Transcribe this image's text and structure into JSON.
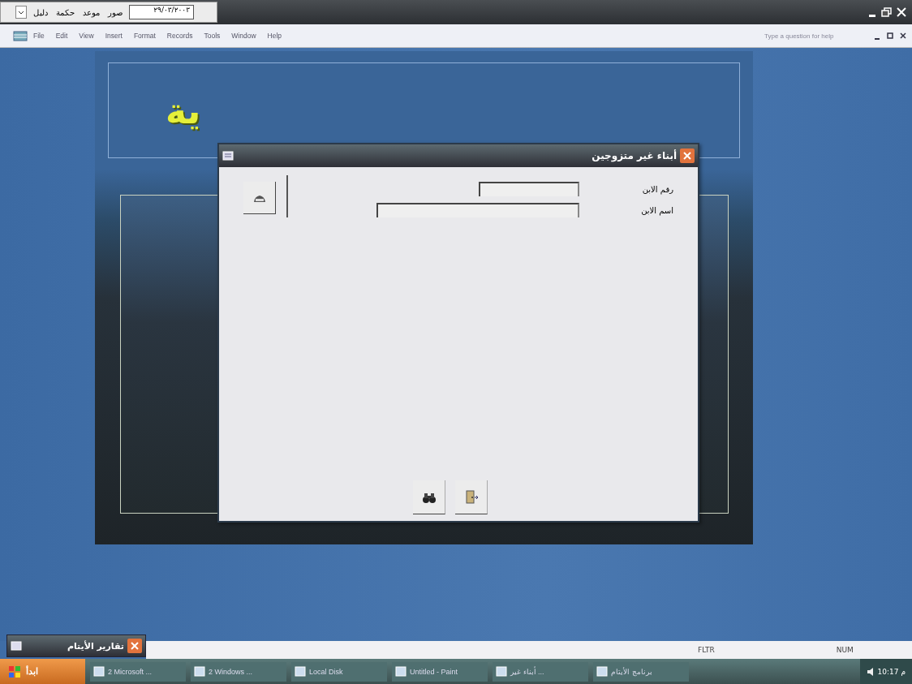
{
  "toolbar": {
    "date_field": "٢٩/٠٣/٢٠٠٣",
    "buttons": [
      "صور",
      "موعد",
      "حكمة",
      "دليل"
    ]
  },
  "menu": [
    "Help",
    "Window",
    "Tools",
    "Records",
    "Format",
    "Insert",
    "View",
    "Edit",
    "File"
  ],
  "help_box": {
    "placeholder": "Type a question for help"
  },
  "banner": {
    "title": "ية"
  },
  "dialog": {
    "title": "أبناء غير متزوجين",
    "fields": [
      {
        "label": "رقم الابن",
        "kind": "short"
      },
      {
        "label": "اسم الابن",
        "kind": "long"
      }
    ]
  },
  "minimized_window": {
    "title": "تقارير الأيتام"
  },
  "status_bar": [
    "NUM",
    "FLTR"
  ],
  "taskbar": {
    "start": "ابدأ",
    "items": [
      "برنامج الأيتام",
      "أبناء غير ...",
      "Untitled - Paint",
      "Local Disk",
      "2 Windows ...",
      "2 Microsoft ..."
    ],
    "clock": "10:17 م"
  }
}
